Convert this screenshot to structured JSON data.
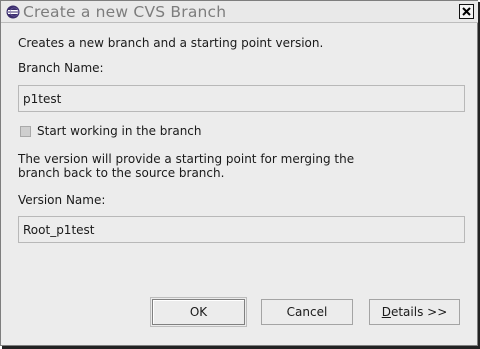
{
  "window": {
    "title": "Create a new CVS Branch"
  },
  "dialog": {
    "description": "Creates a new branch and a starting point version.",
    "branch_name_label": "Branch Name:",
    "branch_name_value": "p1test",
    "start_working_label": "Start working in the branch",
    "start_working_checked": false,
    "version_info_line1": "The version will provide a starting point for merging the",
    "version_info_line2": "branch back to the source branch.",
    "version_name_label": "Version Name:",
    "version_name_value": "Root_p1test"
  },
  "buttons": {
    "ok_label": "OK",
    "cancel_label": "Cancel",
    "details_mnemonic": "D",
    "details_rest": "etails >>"
  },
  "colors": {
    "dialog_bg": "#ececec",
    "title_text": "#7d7d7d",
    "text": "#1a1a1a"
  },
  "icons": [
    "eclipse-app-icon",
    "close-icon"
  ]
}
